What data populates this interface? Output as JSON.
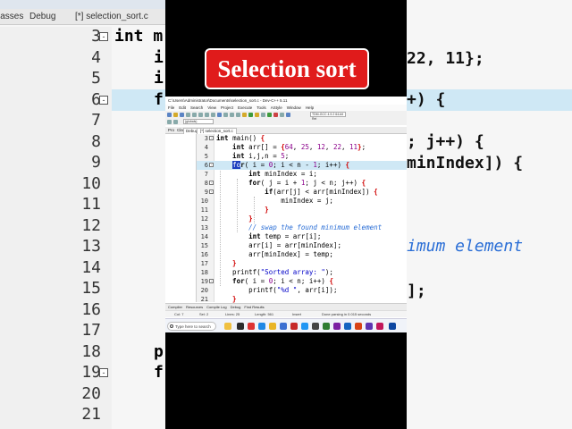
{
  "banner": {
    "title": "Selection sort"
  },
  "background": {
    "tabs": [
      "lasses",
      "Debug",
      "[*] selection_sort.c"
    ],
    "left_lines": [
      {
        "num": "3",
        "code": "int m"
      },
      {
        "num": "4",
        "code": "i"
      },
      {
        "num": "5",
        "code": "i"
      },
      {
        "num": "6",
        "code": "f"
      },
      {
        "num": "7",
        "code": ""
      },
      {
        "num": "8",
        "code": ""
      },
      {
        "num": "9",
        "code": ""
      },
      {
        "num": "10",
        "code": ""
      },
      {
        "num": "11",
        "code": ""
      },
      {
        "num": "12",
        "code": ""
      },
      {
        "num": "13",
        "code": ""
      },
      {
        "num": "14",
        "code": ""
      },
      {
        "num": "15",
        "code": ""
      },
      {
        "num": "16",
        "code": ""
      },
      {
        "num": "17",
        "code": ""
      },
      {
        "num": "18",
        "code": "p"
      },
      {
        "num": "19",
        "code": "f"
      },
      {
        "num": "20",
        "code": ""
      },
      {
        "num": "21",
        "code": ""
      }
    ],
    "right_lines": [
      {
        "code": "22, 11};"
      },
      {
        "code": "+) {"
      },
      {
        "code": "; j++) {"
      },
      {
        "code": "minIndex]) {"
      },
      {
        "code": "imum element"
      },
      {
        "code": "];"
      }
    ]
  },
  "ide": {
    "window_title": "C:\\Users\\Administrator\\Documents\\selection_sort.c - Dev-C++ 5.11",
    "menu": [
      "File",
      "Edit",
      "Search",
      "View",
      "Project",
      "Execute",
      "Tools",
      "AStyle",
      "Window",
      "Help"
    ],
    "compiler": "TDM-GCC 4.9.2 64-bit Rel",
    "globals": "(globals)",
    "panel_tabs": [
      "Pro",
      "Cla",
      "Debug"
    ],
    "file_tab": "[*] selection_sort.c",
    "code_lines": [
      {
        "num": "3",
        "fold": "-",
        "tokens": [
          [
            "kw",
            "int "
          ],
          [
            "id",
            "main() "
          ],
          [
            "pun",
            "{"
          ]
        ]
      },
      {
        "num": "4",
        "fold": "",
        "tokens": [
          [
            "kw",
            "    int "
          ],
          [
            "id",
            "arr[] = "
          ],
          [
            "pun",
            "{"
          ],
          [
            "num",
            "64"
          ],
          [
            "id",
            ", "
          ],
          [
            "num",
            "25"
          ],
          [
            "id",
            ", "
          ],
          [
            "num",
            "12"
          ],
          [
            "id",
            ", "
          ],
          [
            "num",
            "22"
          ],
          [
            "id",
            ", "
          ],
          [
            "num",
            "11"
          ],
          [
            "pun",
            "}"
          ],
          [
            "id",
            ";"
          ]
        ]
      },
      {
        "num": "5",
        "fold": "",
        "tokens": [
          [
            "kw",
            "    int "
          ],
          [
            "id",
            "i,j,n = "
          ],
          [
            "num",
            "5"
          ],
          [
            "id",
            ";"
          ]
        ]
      },
      {
        "num": "6",
        "fold": "-",
        "current": true,
        "tokens": [
          [
            "id",
            "    "
          ],
          [
            "sel",
            "fo"
          ],
          [
            "kw",
            "r"
          ],
          [
            "id",
            "( i = "
          ],
          [
            "num",
            "0"
          ],
          [
            "id",
            "; i < n - "
          ],
          [
            "num",
            "1"
          ],
          [
            "id",
            "; i++) "
          ],
          [
            "pun",
            "{"
          ]
        ]
      },
      {
        "num": "7",
        "fold": "",
        "tokens": [
          [
            "kw",
            "        int "
          ],
          [
            "id",
            "minIndex = i;"
          ]
        ]
      },
      {
        "num": "8",
        "fold": "-",
        "tokens": [
          [
            "kw",
            "        for"
          ],
          [
            "id",
            "( j = i + "
          ],
          [
            "num",
            "1"
          ],
          [
            "id",
            "; j < n; j++) "
          ],
          [
            "pun",
            "{"
          ]
        ]
      },
      {
        "num": "9",
        "fold": "-",
        "tokens": [
          [
            "kw",
            "            if"
          ],
          [
            "id",
            "(arr[j] < arr[minIndex]) "
          ],
          [
            "pun",
            "{"
          ]
        ]
      },
      {
        "num": "10",
        "fold": "",
        "tokens": [
          [
            "id",
            "                minIndex = j;"
          ]
        ]
      },
      {
        "num": "11",
        "fold": "",
        "tokens": [
          [
            "pun",
            "            }"
          ]
        ]
      },
      {
        "num": "12",
        "fold": "",
        "tokens": [
          [
            "pun",
            "        }"
          ]
        ]
      },
      {
        "num": "13",
        "fold": "",
        "tokens": [
          [
            "cmt",
            "        // swap the found minimum element"
          ]
        ]
      },
      {
        "num": "14",
        "fold": "",
        "tokens": [
          [
            "kw",
            "        int "
          ],
          [
            "id",
            "temp = arr[i];"
          ]
        ]
      },
      {
        "num": "15",
        "fold": "",
        "tokens": [
          [
            "id",
            "        arr[i] = arr[minIndex];"
          ]
        ]
      },
      {
        "num": "16",
        "fold": "",
        "tokens": [
          [
            "id",
            "        arr[minIndex] = temp;"
          ]
        ]
      },
      {
        "num": "17",
        "fold": "",
        "tokens": [
          [
            "pun",
            "    }"
          ]
        ]
      },
      {
        "num": "18",
        "fold": "",
        "tokens": [
          [
            "id",
            "    printf("
          ],
          [
            "str",
            "\"Sorted array: \""
          ],
          [
            "id",
            ");"
          ]
        ]
      },
      {
        "num": "19",
        "fold": "-",
        "tokens": [
          [
            "kw",
            "    for"
          ],
          [
            "id",
            "( i = "
          ],
          [
            "num",
            "0"
          ],
          [
            "id",
            "; i < n; i++) "
          ],
          [
            "pun",
            "{"
          ]
        ]
      },
      {
        "num": "20",
        "fold": "",
        "tokens": [
          [
            "id",
            "        printf("
          ],
          [
            "str",
            "\"%d \""
          ],
          [
            "id",
            ", arr[i]);"
          ]
        ]
      },
      {
        "num": "21",
        "fold": "",
        "tokens": [
          [
            "pun",
            "    }"
          ]
        ]
      }
    ],
    "bottom_tabs": [
      "Compiler",
      "Resources",
      "Compile Log",
      "Debug",
      "Find Results"
    ],
    "status": {
      "col": "Col: 7",
      "sel": "Sel: 2",
      "lines": "Lines: 25",
      "length": "Length: 561",
      "mode": "Insert",
      "message": "Done parsing in 0.015 seconds"
    },
    "taskbar": {
      "search_placeholder": "Type here to search"
    }
  },
  "colors": {
    "banner_bg": "#e01b1b",
    "current_line": "#cfe8f5",
    "selection": "#1c3fbf",
    "keyword": "#000000",
    "number": "#8b008b",
    "string": "#0000c8",
    "comment": "#2a6ed6",
    "brace": "#d00000"
  }
}
